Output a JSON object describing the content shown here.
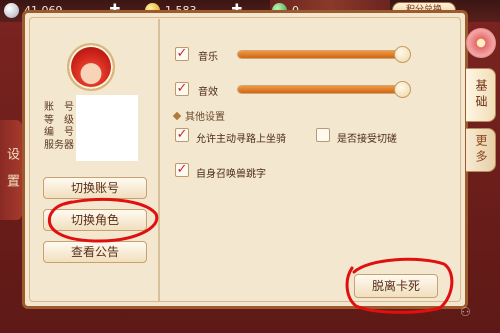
{
  "topbar": {
    "silver": "41,069",
    "gold": "1,583",
    "jade": "0",
    "shop_label": "积分兑换"
  },
  "panel": {
    "vertical_title": "设置"
  },
  "profile": {
    "info_labels": [
      "账　号",
      "等　级",
      "编　号",
      "服务器"
    ]
  },
  "left_buttons": {
    "switch_account": "切换账号",
    "switch_role": "切换角色",
    "announcement": "查看公告"
  },
  "settings": {
    "music_label": "音乐",
    "music_level": 1.0,
    "sound_label": "音效",
    "sound_level": 1.0,
    "other_title": "其他设置",
    "auto_mount_label": "允许主动寻路上坐骑",
    "auto_mount_checked": true,
    "accept_duel_label": "是否接受切磋",
    "accept_duel_checked": false,
    "summon_jump_label": "自身召唤兽跳字",
    "summon_jump_checked": true,
    "unstuck_label": "脱离卡死"
  },
  "side_tabs": {
    "basic": "基础",
    "more": "更多"
  },
  "colors": {
    "accent": "#d2651a",
    "check": "#c9262a",
    "annotation": "#e01010"
  }
}
